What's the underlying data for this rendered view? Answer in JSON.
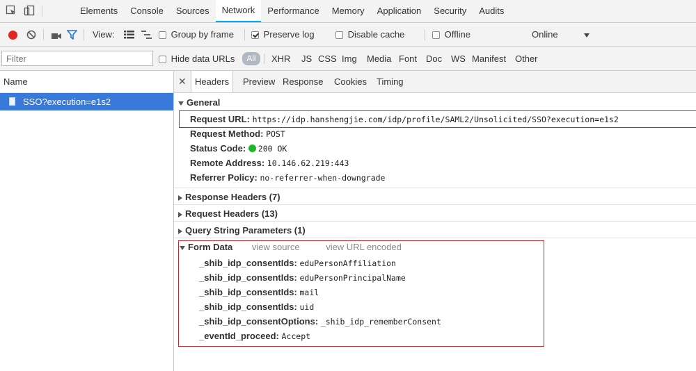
{
  "tabs": {
    "items": [
      "Elements",
      "Console",
      "Sources",
      "Network",
      "Performance",
      "Memory",
      "Application",
      "Security",
      "Audits"
    ],
    "active": "Network"
  },
  "toolbar": {
    "view_label": "View:",
    "group_by_frame": "Group by frame",
    "preserve_log": "Preserve log",
    "disable_cache": "Disable cache",
    "offline": "Offline",
    "online": "Online"
  },
  "filter": {
    "placeholder": "Filter",
    "hide_data_urls": "Hide data URLs",
    "types": [
      "All",
      "XHR",
      "JS",
      "CSS",
      "Img",
      "Media",
      "Font",
      "Doc",
      "WS",
      "Manifest",
      "Other"
    ]
  },
  "requests": {
    "header": "Name",
    "items": [
      "SSO?execution=e1s2"
    ]
  },
  "detail_tabs": [
    "Headers",
    "Preview",
    "Response",
    "Cookies",
    "Timing"
  ],
  "general": {
    "title": "General",
    "rows": [
      {
        "k": "Request URL:",
        "v": "https://idp.hanshengjie.com/idp/profile/SAML2/Unsolicited/SSO?execution=e1s2"
      },
      {
        "k": "Request Method:",
        "v": "POST"
      },
      {
        "k": "Status Code:",
        "v": "200 OK"
      },
      {
        "k": "Remote Address:",
        "v": "10.146.62.219:443"
      },
      {
        "k": "Referrer Policy:",
        "v": "no-referrer-when-downgrade"
      }
    ]
  },
  "collapsed_sections": [
    "Response Headers (7)",
    "Request Headers (13)",
    "Query String Parameters (1)"
  ],
  "form_data": {
    "title": "Form Data",
    "view_source": "view source",
    "view_url_encoded": "view URL encoded",
    "rows": [
      {
        "k": "_shib_idp_consentIds:",
        "v": "eduPersonAffiliation"
      },
      {
        "k": "_shib_idp_consentIds:",
        "v": "eduPersonPrincipalName"
      },
      {
        "k": "_shib_idp_consentIds:",
        "v": "mail"
      },
      {
        "k": "_shib_idp_consentIds:",
        "v": "uid"
      },
      {
        "k": "_shib_idp_consentOptions:",
        "v": "_shib_idp_rememberConsent"
      },
      {
        "k": "_eventId_proceed:",
        "v": "Accept"
      }
    ]
  },
  "colors": {
    "accent": "#03a9f4",
    "record": "#e0261e",
    "selected_row": "#3879d9",
    "status_ok": "#1eb72a",
    "highlight_box": "#c0292d"
  }
}
